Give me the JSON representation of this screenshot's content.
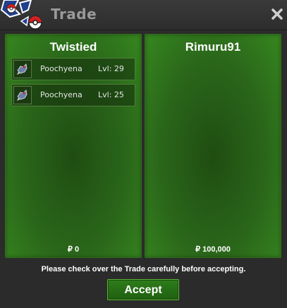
{
  "window": {
    "title": "Trade"
  },
  "panels": {
    "left": {
      "player_name": "Twistied",
      "items": [
        {
          "name": "Poochyena",
          "level": "Lvl: 29"
        },
        {
          "name": "Poochyena",
          "level": "Lvl: 25"
        }
      ],
      "money": "₽ 0"
    },
    "right": {
      "player_name": "Rimuru91",
      "items": [],
      "money": "₽ 100,000"
    }
  },
  "footer": {
    "notice": "Please check over the Trade carefully before accepting.",
    "accept_label": "Accept"
  },
  "colors": {
    "panel_green": "#2a661a",
    "button_green": "#2e7d1b",
    "title_gray": "#9a9a9a"
  },
  "icons": {
    "logo": "pokeball-logo-icon",
    "close": "close-icon",
    "item": "pokemon-sprite-icon"
  }
}
